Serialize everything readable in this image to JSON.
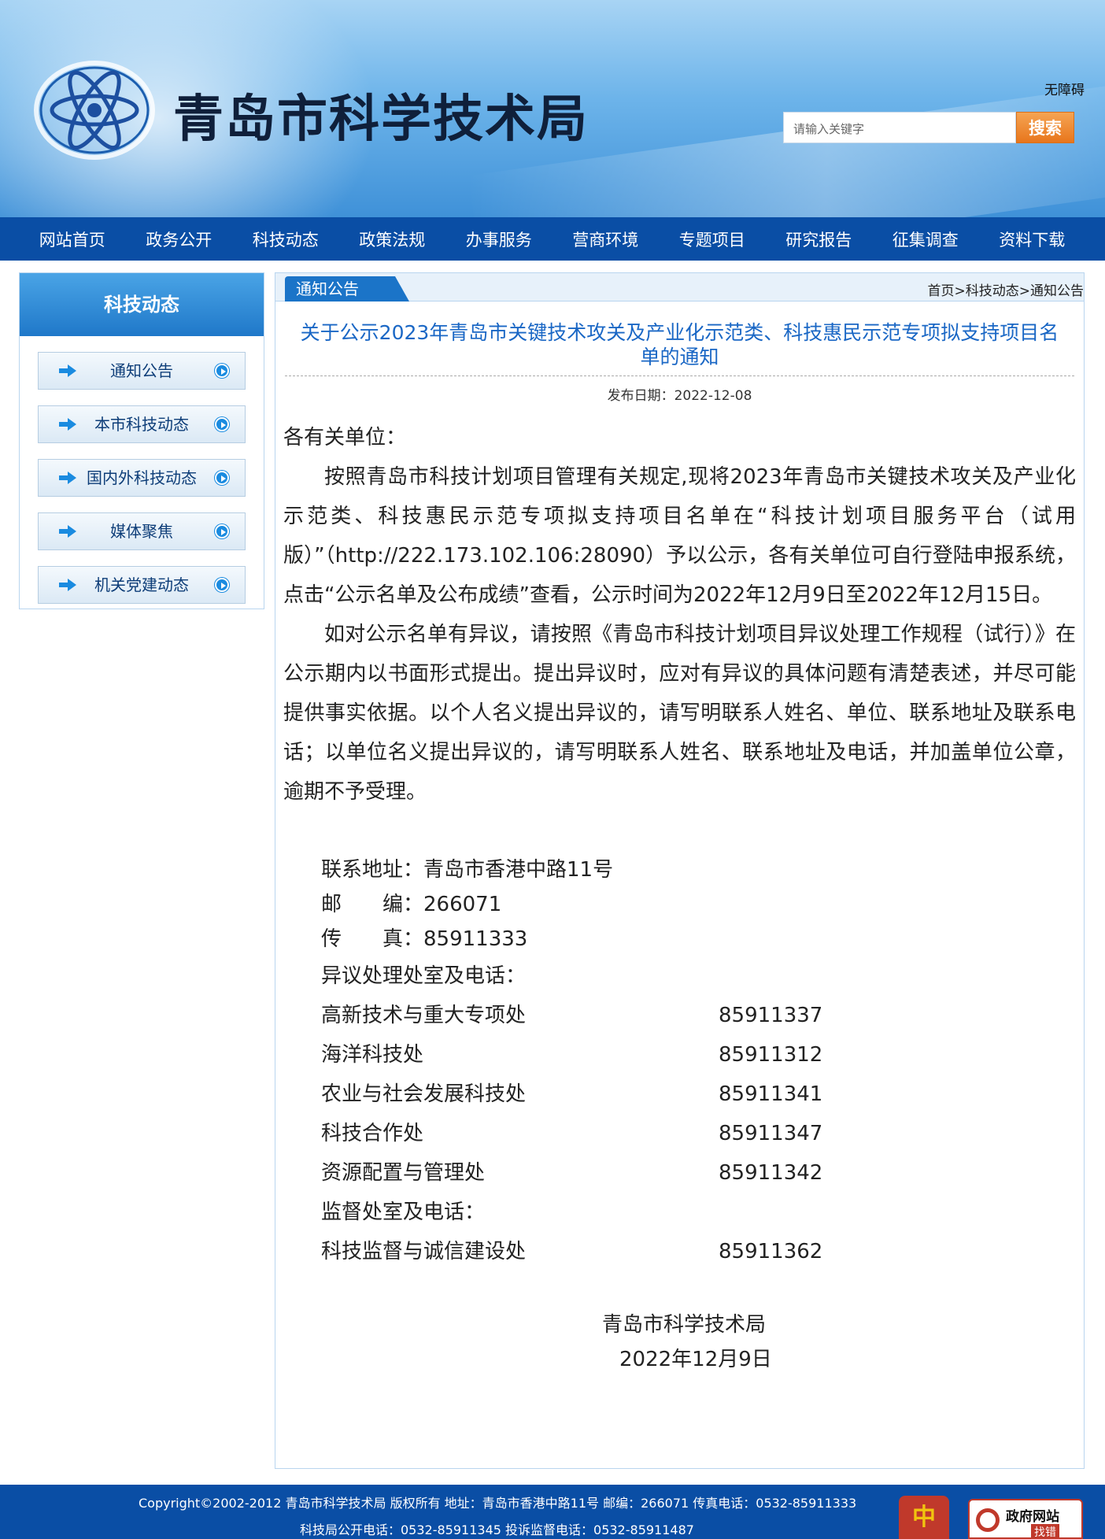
{
  "header": {
    "site_title": "青岛市科学技术局",
    "accessibility": "无障碍",
    "search_placeholder": "请输入关键字",
    "search_button": "搜索"
  },
  "nav": {
    "items": [
      "网站首页",
      "政务公开",
      "科技动态",
      "政策法规",
      "办事服务",
      "营商环境",
      "专题项目",
      "研究报告",
      "征集调查",
      "资料下载"
    ]
  },
  "sidebar": {
    "title": "科技动态",
    "items": [
      "通知公告",
      "本市科技动态",
      "国内外科技动态",
      "媒体聚焦",
      "机关党建动态"
    ]
  },
  "main": {
    "section_tab": "通知公告",
    "breadcrumb": "首页>科技动态>通知公告",
    "title": "关于公示2023年青岛市关键技术攻关及产业化示范类、科技惠民示范专项拟支持项目名单的通知",
    "pub_date": "发布日期：2022-12-08",
    "greeting": "各有关单位：",
    "para1": "按照青岛市科技计划项目管理有关规定,现将2023年青岛市关键技术攻关及产业化示范类、科技惠民示范专项拟支持项目名单在“科技计划项目服务平台（试用版）”（http://222.173.102.106:28090）予以公示，各有关单位可自行登陆申报系统，点击“公示名单及公布成绩”查看，公示时间为2022年12月9日至2022年12月15日。",
    "para2": "如对公示名单有异议，请按照《青岛市科技计划项目异议处理工作规程（试行）》在公示期内以书面形式提出。提出异议时，应对有异议的具体问题有清楚表述，并尽可能提供事实依据。以个人名义提出异议的，请写明联系人姓名、单位、联系地址及联系电话；以单位名义提出异议的，请写明联系人姓名、联系地址及电话，并加盖单位公章，逾期不予受理。",
    "contact": {
      "address": "联系地址：青岛市香港中路11号",
      "postcode": "邮　　编：266071",
      "fax": "传　　真：85911333",
      "objection_heading": "异议处理处室及电话：",
      "objection_rows": [
        {
          "dept": "高新技术与重大专项处",
          "phone": "85911337"
        },
        {
          "dept": "海洋科技处",
          "phone": "85911312"
        },
        {
          "dept": "农业与社会发展科技处",
          "phone": "85911341"
        },
        {
          "dept": "科技合作处",
          "phone": "85911347"
        },
        {
          "dept": "资源配置与管理处",
          "phone": "85911342"
        }
      ],
      "supervision_heading": "监督处室及电话：",
      "supervision_rows": [
        {
          "dept": "科技监督与诚信建设处",
          "phone": "85911362"
        }
      ]
    },
    "signature_org": "青岛市科学技术局",
    "signature_date": "2022年12月9日"
  },
  "footer": {
    "line1": "Copyright©2002-2012 青岛市科学技术局 版权所有 地址：青岛市香港中路11号 邮编：266071 传真电话：0532-85911333",
    "line2": "科技局公开电话：0532-85911345 投诉监督电话：0532-85911487",
    "gov_badge": "政府网站",
    "gov_badge_sub": "找错"
  },
  "colors": {
    "nav_bg": "#0a4ea5",
    "title_blue": "#1a67c5",
    "search_orange": "#e8761c"
  }
}
